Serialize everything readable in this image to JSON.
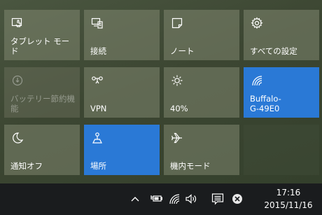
{
  "tiles": [
    {
      "label": "タブレット モード",
      "icon": "tablet-mode-icon"
    },
    {
      "label": "接続",
      "icon": "connect-icon"
    },
    {
      "label": "ノート",
      "icon": "note-icon"
    },
    {
      "label": "すべての設定",
      "icon": "gear-icon"
    },
    {
      "label": "バッテリー節約機\n能",
      "icon": "battery-saver-icon"
    },
    {
      "label": "VPN",
      "icon": "vpn-icon"
    },
    {
      "label": "40%",
      "icon": "brightness-icon"
    },
    {
      "label": "Buffalo-\nG-49E0",
      "icon": "wifi-icon"
    },
    {
      "label": "通知オフ",
      "icon": "quiet-hours-icon"
    },
    {
      "label": "場所",
      "icon": "location-icon"
    },
    {
      "label": "機内モード",
      "icon": "airplane-icon"
    }
  ],
  "taskbar": {
    "time": "17:16",
    "date": "2015/11/16",
    "icons": [
      "show-hidden-icons-icon",
      "power-icon",
      "network-icon",
      "volume-icon",
      "action-center-icon",
      "close-icon"
    ]
  },
  "colors": {
    "accent": "#2a79d6",
    "taskbar": "#1a1c1e"
  }
}
